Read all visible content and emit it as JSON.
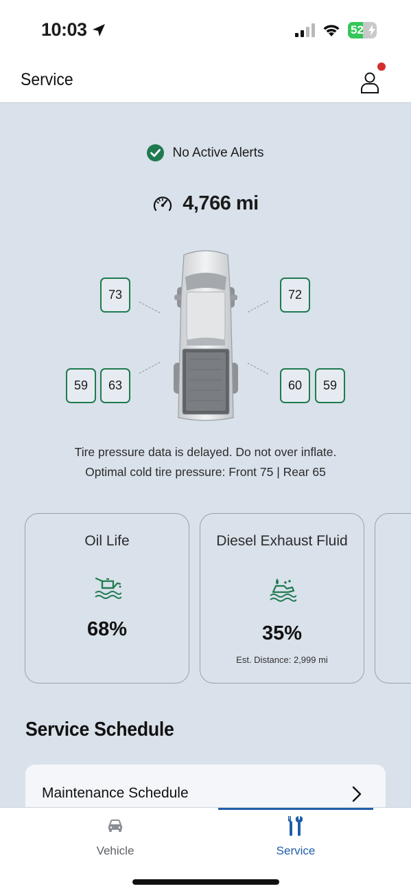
{
  "status_bar": {
    "time": "10:03",
    "battery_percent": 52,
    "battery_label": "52"
  },
  "header": {
    "title": "Service",
    "profile_notification": true
  },
  "alerts": {
    "text": "No Active Alerts"
  },
  "odometer": {
    "value": "4,766 mi"
  },
  "tires": {
    "front_left": "73",
    "front_right": "72",
    "rear_left_outer": "59",
    "rear_left_inner": "63",
    "rear_right_inner": "60",
    "rear_right_outer": "59"
  },
  "tire_note": {
    "line1": "Tire pressure data is delayed. Do not over inflate.",
    "line2": "Optimal cold tire pressure: Front 75 | Rear 65"
  },
  "cards": {
    "oil": {
      "title": "Oil Life",
      "icon": "oil-can-icon",
      "value": "68%"
    },
    "def": {
      "title": "Diesel Exhaust Fluid",
      "icon": "def-fluid-icon",
      "value": "35%",
      "sub": "Est. Distance: 2,999 mi"
    }
  },
  "schedule": {
    "section_title": "Service Schedule",
    "row_label": "Maintenance Schedule"
  },
  "nav": {
    "vehicle_label": "Vehicle",
    "service_label": "Service",
    "active": "Service"
  },
  "colors": {
    "accent_green": "#1f7a4f",
    "accent_blue": "#1f5ea8",
    "page_bg": "#d9e1ea",
    "notification_red": "#d62d2d"
  }
}
